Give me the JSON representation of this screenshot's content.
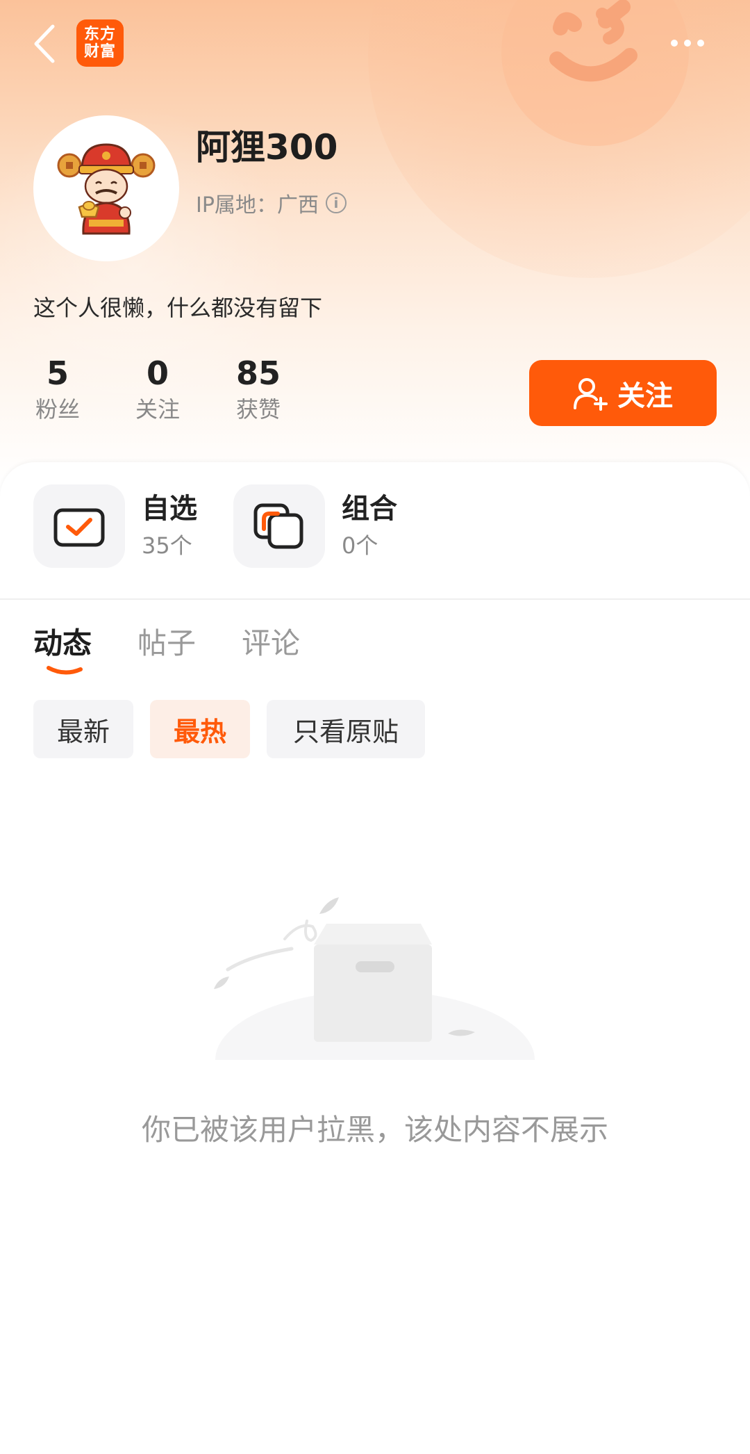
{
  "nav": {
    "logo_line1": "东方",
    "logo_line2": "财富"
  },
  "profile": {
    "username": "阿狸300",
    "ip_location": "IP属地：广西",
    "bio": "这个人很懒，什么都没有留下",
    "follow_label": "关注"
  },
  "stats": [
    {
      "value": "5",
      "label": "粉丝"
    },
    {
      "value": "0",
      "label": "关注"
    },
    {
      "value": "85",
      "label": "获赞"
    }
  ],
  "shortcuts": [
    {
      "title": "自选",
      "count": "35个"
    },
    {
      "title": "组合",
      "count": "0个"
    }
  ],
  "tabs": [
    {
      "label": "动态",
      "active": true
    },
    {
      "label": "帖子",
      "active": false
    },
    {
      "label": "评论",
      "active": false
    }
  ],
  "filters": [
    {
      "label": "最新",
      "active": false
    },
    {
      "label": "最热",
      "active": true
    },
    {
      "label": "只看原贴",
      "active": false
    }
  ],
  "empty_state": {
    "message": "你已被该用户拉黑，该处内容不展示"
  },
  "colors": {
    "accent": "#ff5a0a",
    "accent_light": "#fdeee6",
    "header_gradient_top": "#fbc29a"
  }
}
